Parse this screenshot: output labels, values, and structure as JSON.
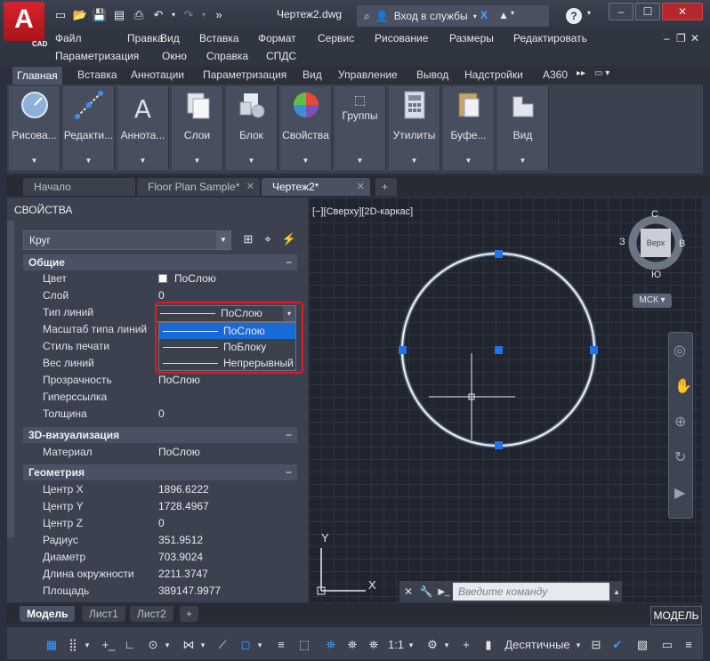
{
  "app": {
    "title": "Чертеж2.dwg",
    "logo_letter": "A",
    "logo_sub": "CAD",
    "search_label": "Вход в службы",
    "help": "?",
    "win_min": "–",
    "win_max": "☐",
    "win_close": "✕"
  },
  "menu": {
    "row1": [
      "Файл",
      "Правка",
      "Вид",
      "Вставка",
      "Формат",
      "Сервис",
      "Рисование",
      "Размеры",
      "Редактировать"
    ],
    "row2": [
      "Параметризация",
      "Окно",
      "Справка",
      "СПДС"
    ],
    "doc_min": "–",
    "doc_max": "❐",
    "doc_close": "✕"
  },
  "ribbon": {
    "tabs": [
      "Главная",
      "Вставка",
      "Аннотации",
      "Параметризация",
      "Вид",
      "Управление",
      "Вывод",
      "Надстройки",
      "A360"
    ],
    "panels": [
      "Рисова...",
      "Редакти...",
      "Аннота...",
      "Слои",
      "Блок",
      "Свойства",
      "Группы",
      "Утилиты",
      "Буфе...",
      "Вид"
    ]
  },
  "doctabs": {
    "tabs": [
      "Начало",
      "Floor Plan Sample*",
      "Чертеж2*"
    ],
    "close": "✕",
    "add": "+"
  },
  "properties": {
    "title": "СВОЙСТВА",
    "selection": "Круг",
    "sections": {
      "general": "Общие",
      "viz3d": "3D-визуализация",
      "geometry": "Геометрия"
    },
    "collapse": "−",
    "general_rows": [
      {
        "k": "Цвет",
        "v": "ПоСлою"
      },
      {
        "k": "Слой",
        "v": "0"
      },
      {
        "k": "Тип линий",
        "v": "ПоСлою"
      },
      {
        "k": "Масштаб типа линий",
        "v": ""
      },
      {
        "k": "Стиль печати",
        "v": ""
      },
      {
        "k": "Вес линий",
        "v": ""
      },
      {
        "k": "Прозрачность",
        "v": "ПоСлою"
      },
      {
        "k": "Гиперссылка",
        "v": ""
      },
      {
        "k": "Толщина",
        "v": "0"
      }
    ],
    "viz_rows": [
      {
        "k": "Материал",
        "v": "ПоСлою"
      }
    ],
    "geometry_rows": [
      {
        "k": "Центр X",
        "v": "1896.6222"
      },
      {
        "k": "Центр Y",
        "v": "1728.4967"
      },
      {
        "k": "Центр Z",
        "v": "0"
      },
      {
        "k": "Радиус",
        "v": "351.9512"
      },
      {
        "k": "Диаметр",
        "v": "703.9024"
      },
      {
        "k": "Длина окружности",
        "v": "2211.3747"
      },
      {
        "k": "Площадь",
        "v": "389147.9977"
      }
    ],
    "linetype_dropdown": [
      "ПоСлою",
      "ПоБлоку",
      "Непрерывный"
    ],
    "linetype_selected_index": 0
  },
  "viewport": {
    "label": "[−][Сверху][2D-каркас]",
    "cube_top": "Верх",
    "dir_n": "С",
    "dir_s": "Ю",
    "dir_w": "З",
    "dir_e": "В",
    "ucs_name": "МСК",
    "axis_y": "Y",
    "axis_x": "X"
  },
  "command": {
    "placeholder": "Введите команду"
  },
  "layouts": {
    "tabs": [
      "Модель",
      "Лист1",
      "Лист2"
    ],
    "add": "+",
    "model_button": "МОДЕЛЬ"
  },
  "status": {
    "scale": "1:1",
    "units": "Десятичные"
  },
  "colors": {
    "accent_blue": "#1a6ad6",
    "highlight_red": "#e01c1c",
    "logo_red": "#d8232a",
    "grip_blue": "#1e74e8"
  }
}
